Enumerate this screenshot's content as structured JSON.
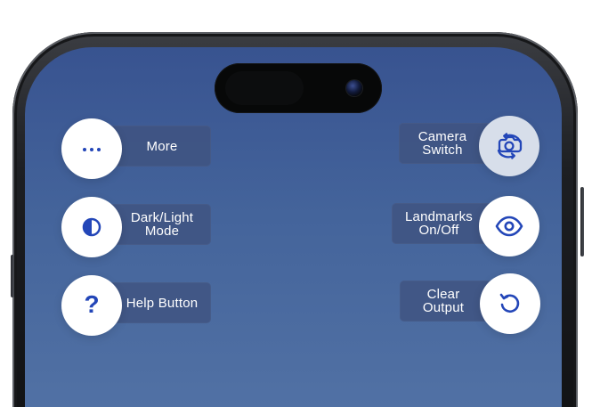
{
  "controls": {
    "more": {
      "label": "More",
      "icon": "more-icon"
    },
    "dark_light": {
      "label": "Dark/Light\nMode",
      "icon": "contrast-icon"
    },
    "help": {
      "label": "Help Button",
      "icon": "question-icon",
      "symbol": "?"
    },
    "camera_switch": {
      "label": "Camera\nSwitch",
      "icon": "camera-switch-icon"
    },
    "landmarks": {
      "label": "Landmarks\nOn/Off",
      "icon": "eye-icon"
    },
    "clear_output": {
      "label": "Clear\nOutput",
      "icon": "reset-icon"
    }
  },
  "colors": {
    "screen_top": "#385390",
    "screen_bottom": "#5272a5",
    "accent": "#2346b8",
    "pill": "#405380",
    "button": "#ffffff",
    "button_light": "#d7deea"
  }
}
